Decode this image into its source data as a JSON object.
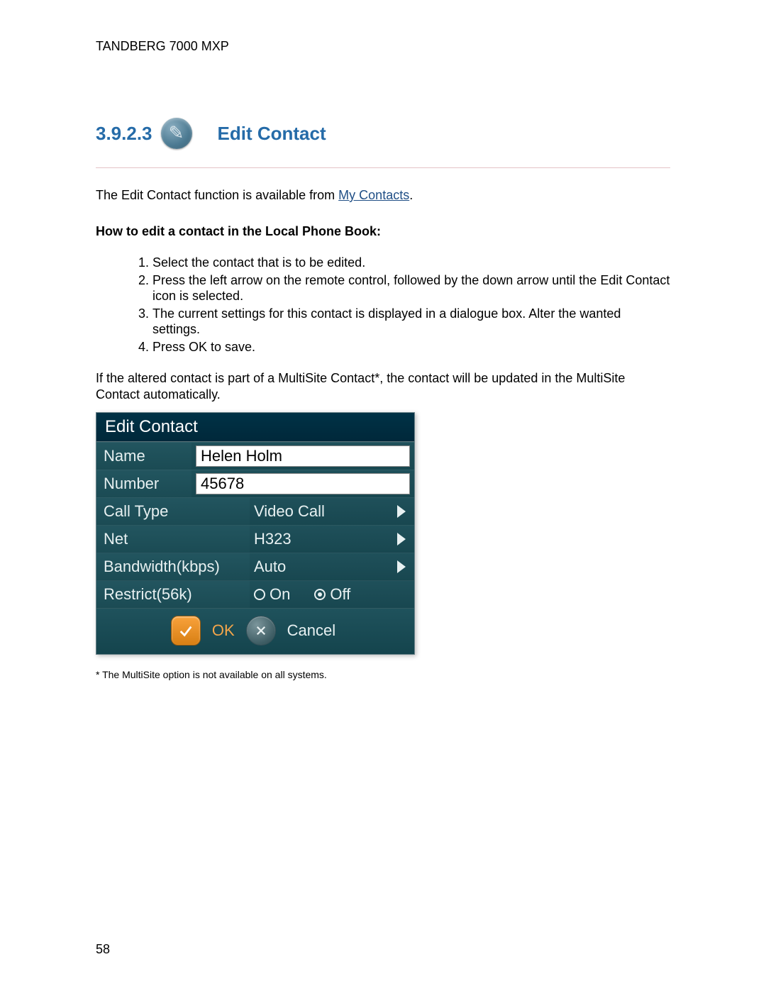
{
  "header": {
    "product": "TANDBERG 7000 MXP"
  },
  "section": {
    "number": "3.9.2.3",
    "icon": "pencil-icon",
    "title": "Edit Contact"
  },
  "intro": {
    "before_link": "The Edit Contact function is available from ",
    "link_text": "My Contacts",
    "after_link": "."
  },
  "howto_title": "How to edit a contact in the Local Phone Book:",
  "steps": [
    "Select the contact that is to be edited.",
    "Press the left arrow on the remote control, followed by the down arrow until the Edit Contact icon is selected.",
    "The current settings for this contact is displayed in a dialogue box. Alter the wanted settings.",
    "Press OK to save."
  ],
  "paragraph_after": "If the altered contact is part of a MultiSite Contact*, the contact will be updated in the MultiSite Contact automatically.",
  "dialog": {
    "title": "Edit Contact",
    "rows": {
      "name": {
        "label": "Name",
        "value": "Helen Holm"
      },
      "number": {
        "label": "Number",
        "value": "45678"
      },
      "calltype": {
        "label": "Call Type",
        "value": "Video Call"
      },
      "net": {
        "label": "Net",
        "value": "H323"
      },
      "bandwidth": {
        "label": "Bandwidth(kbps)",
        "value": "Auto"
      },
      "restrict": {
        "label": "Restrict(56k)"
      }
    },
    "radio": {
      "on_label": "On",
      "off_label": "Off",
      "selected": "Off"
    },
    "actions": {
      "ok": "OK",
      "cancel": "Cancel"
    }
  },
  "footnote": "* The MultiSite option is not available on all systems.",
  "page_number": "58"
}
